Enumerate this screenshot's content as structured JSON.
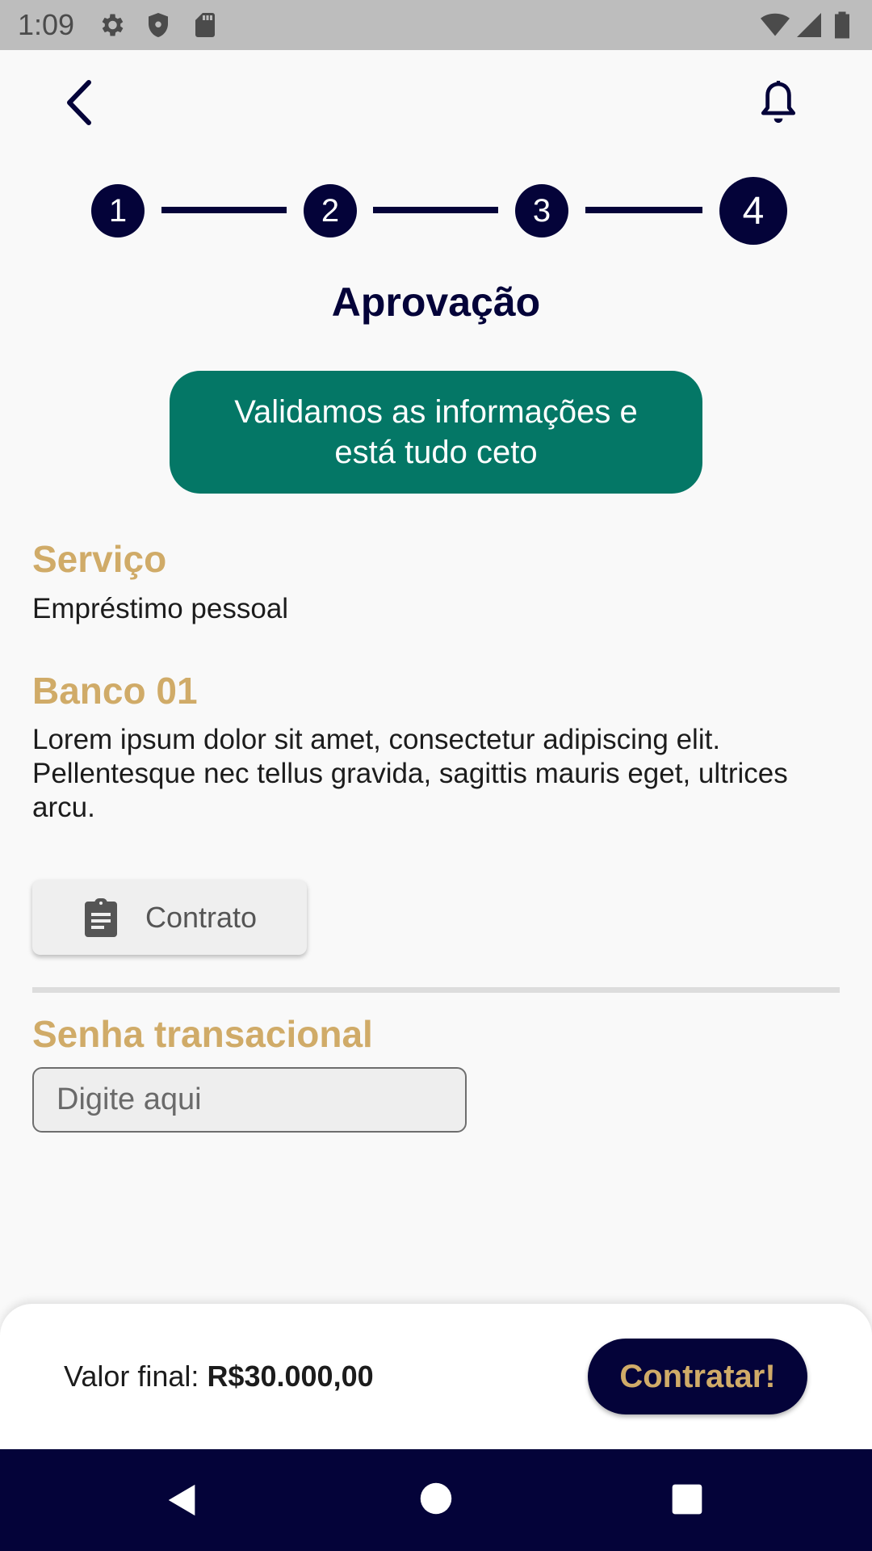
{
  "status_bar": {
    "time": "1:09",
    "icons": [
      "settings-icon",
      "shield-icon",
      "sd-card-icon",
      "wifi-icon",
      "signal-icon",
      "battery-icon"
    ]
  },
  "header": {
    "back_icon": "chevron-left-icon",
    "bell_icon": "bell-icon"
  },
  "stepper": {
    "steps": [
      "1",
      "2",
      "3",
      "4"
    ],
    "current_step": "4"
  },
  "page": {
    "title": "Aprovação",
    "notice": "Validamos as informações e está tudo ceto"
  },
  "service": {
    "label": "Serviço",
    "value": "Empréstimo pessoal"
  },
  "bank": {
    "label": "Banco 01",
    "description": "Lorem ipsum dolor sit amet, consectetur adipiscing elit. Pellentesque nec tellus gravida, sagittis mauris eget, ultrices arcu."
  },
  "contract": {
    "label": "Contrato",
    "icon": "clipboard-icon"
  },
  "password": {
    "label": "Senha transacional",
    "placeholder": "Digite aqui",
    "value": ""
  },
  "footer": {
    "final_label": "Valor final:",
    "final_amount": "R$30.000,00",
    "hire_label": "Contratar!"
  },
  "nav": {
    "icons": [
      "back-triangle-icon",
      "home-circle-icon",
      "recents-square-icon"
    ]
  },
  "colors": {
    "navy": "#040339",
    "gold": "#d0ab68",
    "teal": "#047766",
    "background": "#f9f9f9"
  }
}
